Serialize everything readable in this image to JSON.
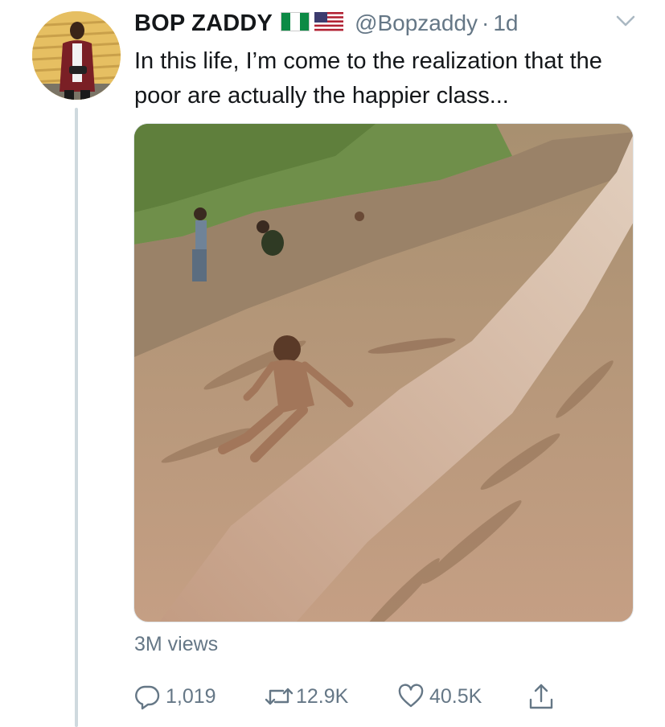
{
  "tweet": {
    "author_name": "BOP ZADDY",
    "flags": [
      "nigeria-flag-icon",
      "usa-flag-icon"
    ],
    "handle": "@Bopzaddy",
    "separator": "·",
    "time": "1d",
    "text": "In this life, I’m come to the realization that the poor are actually the happier class...",
    "views": "3M views"
  },
  "actions": {
    "replies": "1,019",
    "retweets": "12.9K",
    "likes": "40.5K"
  },
  "colors": {
    "text": "#14171a",
    "secondary": "#657786",
    "thread_line": "#cfd9de",
    "nigeria_green": "#0c8a45"
  }
}
